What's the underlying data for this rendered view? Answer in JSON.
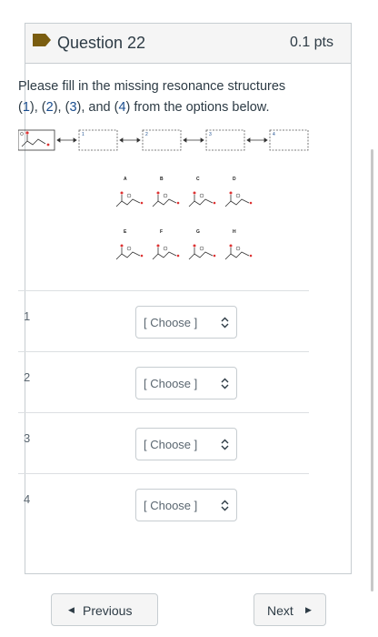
{
  "question": {
    "title": "Question 22",
    "points": "0.1 pts",
    "flag_color": "#7a5d10"
  },
  "prompt": {
    "line1": "Please fill in the missing resonance structures",
    "n1": "1",
    "n2": "2",
    "n3": "3",
    "n4": "4",
    "tail": "from the options below."
  },
  "chain": {
    "box_labels": [
      "1",
      "2",
      "3",
      "4"
    ]
  },
  "options": {
    "top_row": [
      "A",
      "B",
      "C",
      "D"
    ],
    "bottom_row": [
      "E",
      "F",
      "G",
      "H"
    ]
  },
  "answers": [
    {
      "label": "1",
      "value": "[ Choose ]"
    },
    {
      "label": "2",
      "value": "[ Choose ]"
    },
    {
      "label": "3",
      "value": "[ Choose ]"
    },
    {
      "label": "4",
      "value": "[ Choose ]"
    }
  ],
  "nav": {
    "previous": "Previous",
    "next": "Next"
  }
}
